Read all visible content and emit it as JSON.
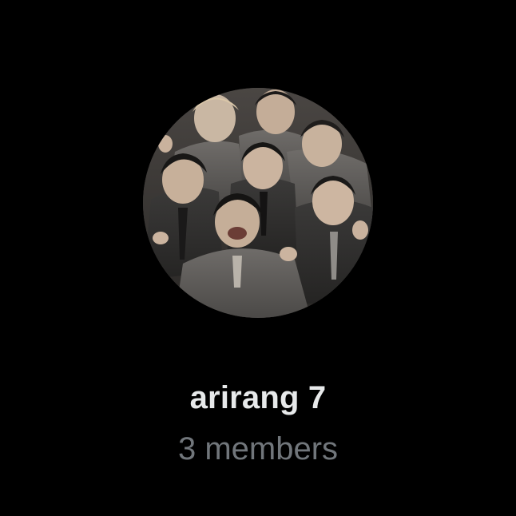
{
  "group": {
    "name": "arirang 7",
    "members_label": "3 members"
  },
  "avatar": {
    "icon": "group-photo"
  },
  "colors": {
    "background": "#000000",
    "name_text": "#e7e9ea",
    "secondary_text": "#71767b"
  }
}
